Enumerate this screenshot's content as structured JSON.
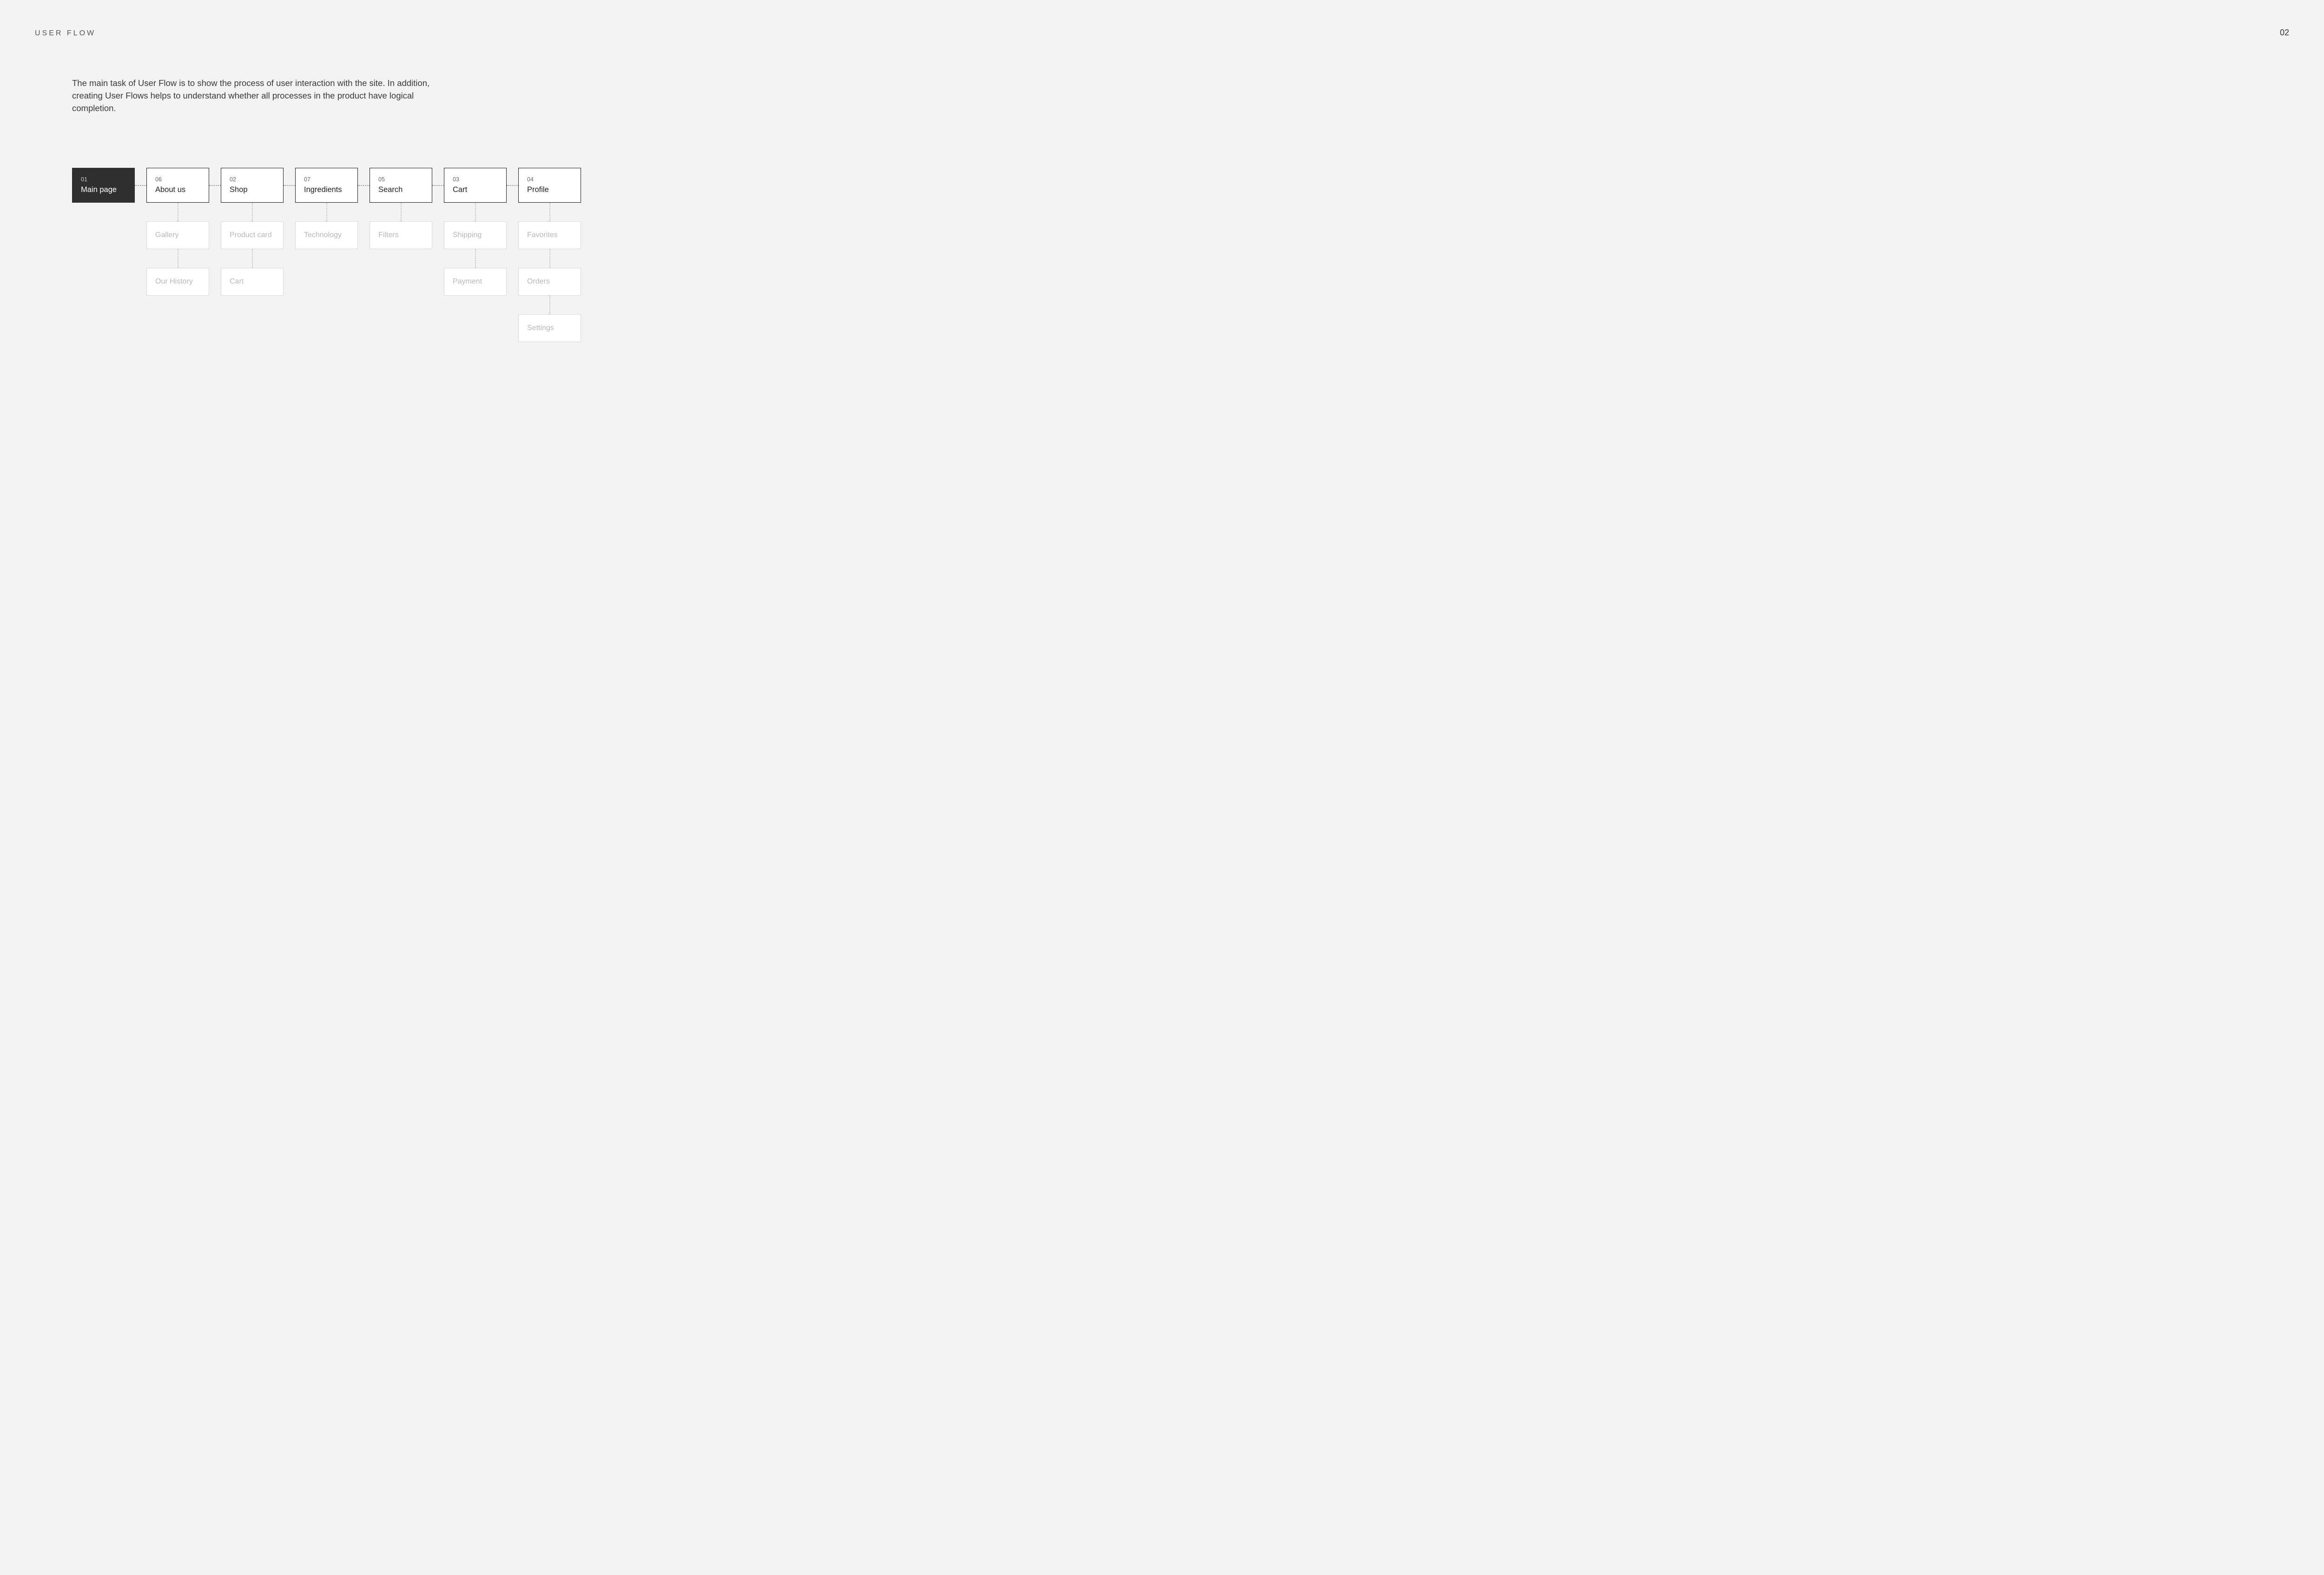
{
  "header": {
    "section_title": "USER FLOW",
    "page_number": "02"
  },
  "description": "The main task of User Flow is to show the process of user interaction with the site. In addition, creating User Flows helps to understand whether all processes in the product have logical completion.",
  "flow": {
    "root": {
      "num": "01",
      "label": "Main page"
    },
    "columns": [
      {
        "num": "06",
        "label": "About us",
        "children": [
          "Gallery",
          "Our History"
        ]
      },
      {
        "num": "02",
        "label": "Shop",
        "children": [
          "Product card",
          "Cart"
        ]
      },
      {
        "num": "07",
        "label": "Ingredients",
        "children": [
          "Technology"
        ]
      },
      {
        "num": "05",
        "label": "Search",
        "children": [
          "Filters"
        ]
      },
      {
        "num": "03",
        "label": "Cart",
        "children": [
          "Shipping",
          "Payment"
        ]
      },
      {
        "num": "04",
        "label": "Profile",
        "children": [
          "Favorites",
          "Orders",
          "Settings"
        ]
      }
    ]
  }
}
